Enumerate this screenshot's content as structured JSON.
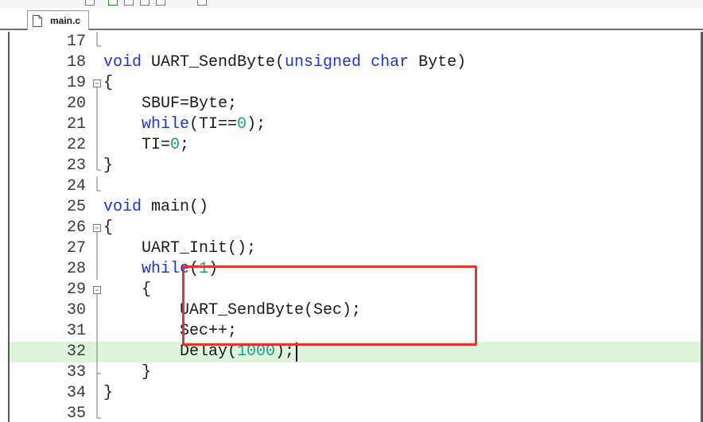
{
  "tab": {
    "label": "main.c"
  },
  "lines": [
    {
      "num": "17",
      "code": ""
    },
    {
      "num": "18",
      "code": "void UART_SendByte(unsigned char Byte)"
    },
    {
      "num": "19",
      "code": "{"
    },
    {
      "num": "20",
      "code": "    SBUF=Byte;"
    },
    {
      "num": "21",
      "code": "    while(TI==0);"
    },
    {
      "num": "22",
      "code": "    TI=0;"
    },
    {
      "num": "23",
      "code": "}"
    },
    {
      "num": "24",
      "code": ""
    },
    {
      "num": "25",
      "code": "void main()"
    },
    {
      "num": "26",
      "code": "{"
    },
    {
      "num": "27",
      "code": "    UART_Init();"
    },
    {
      "num": "28",
      "code": "    while(1)"
    },
    {
      "num": "29",
      "code": "    {"
    },
    {
      "num": "30",
      "code": "        UART_SendByte(Sec);"
    },
    {
      "num": "31",
      "code": "        Sec++;"
    },
    {
      "num": "32",
      "code": "        Delay(1000);"
    },
    {
      "num": "33",
      "code": "    }"
    },
    {
      "num": "34",
      "code": "}"
    },
    {
      "num": "35",
      "code": ""
    }
  ],
  "current_line": "32",
  "colors": {
    "keyword": "#1d35c8",
    "number": "#1a9e86",
    "current_line_bg": "#ddf5dd",
    "highlight_box": "#e23434"
  },
  "keywords": [
    "void",
    "unsigned",
    "char",
    "while"
  ],
  "fold_markers": {
    "17": "end",
    "19": "open",
    "20": "line",
    "21": "line",
    "22": "line",
    "23": "end",
    "24": "end",
    "26": "open",
    "27": "line",
    "28": "line",
    "29": "open",
    "30": "line",
    "31": "line",
    "32": "line",
    "33": "tick",
    "34": "line",
    "35": "end"
  }
}
